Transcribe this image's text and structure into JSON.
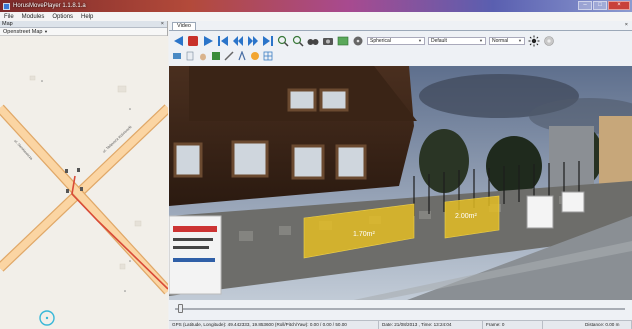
{
  "window": {
    "title": "HorusMovePlayer 1.1.8.1.a"
  },
  "menu": [
    "File",
    "Modules",
    "Options",
    "Help"
  ],
  "map_panel": {
    "header": "Map",
    "close_symbol": "×",
    "source": "Openstreet Map",
    "street_labels": [
      "ul. Tadeusza Kościuszki",
      "ul. Sienkiewicza"
    ]
  },
  "video_panel": {
    "tab": "Video",
    "close_symbol": "×",
    "toolbar": {
      "projection": "Spherical",
      "view": "Default",
      "mode": "Normal"
    },
    "measurements": [
      {
        "label": "1.70m²"
      },
      {
        "label": "2.00m²"
      }
    ]
  },
  "status": {
    "gps": "GPS (Latitude, Longitude): 49.442333, 19.853600  (Roll/Pitch/Yaw): 0.00 / 0.00 / 50.00",
    "date": "Date: 21/08/2013 , Time: 13:24:04",
    "frame": "Frame: 0",
    "distance": "Distance: 0.00 m"
  },
  "colors": {
    "accent": "#2a74c9",
    "record": "#c8312a",
    "measure": "#e8c021",
    "track": "#d94a38"
  }
}
